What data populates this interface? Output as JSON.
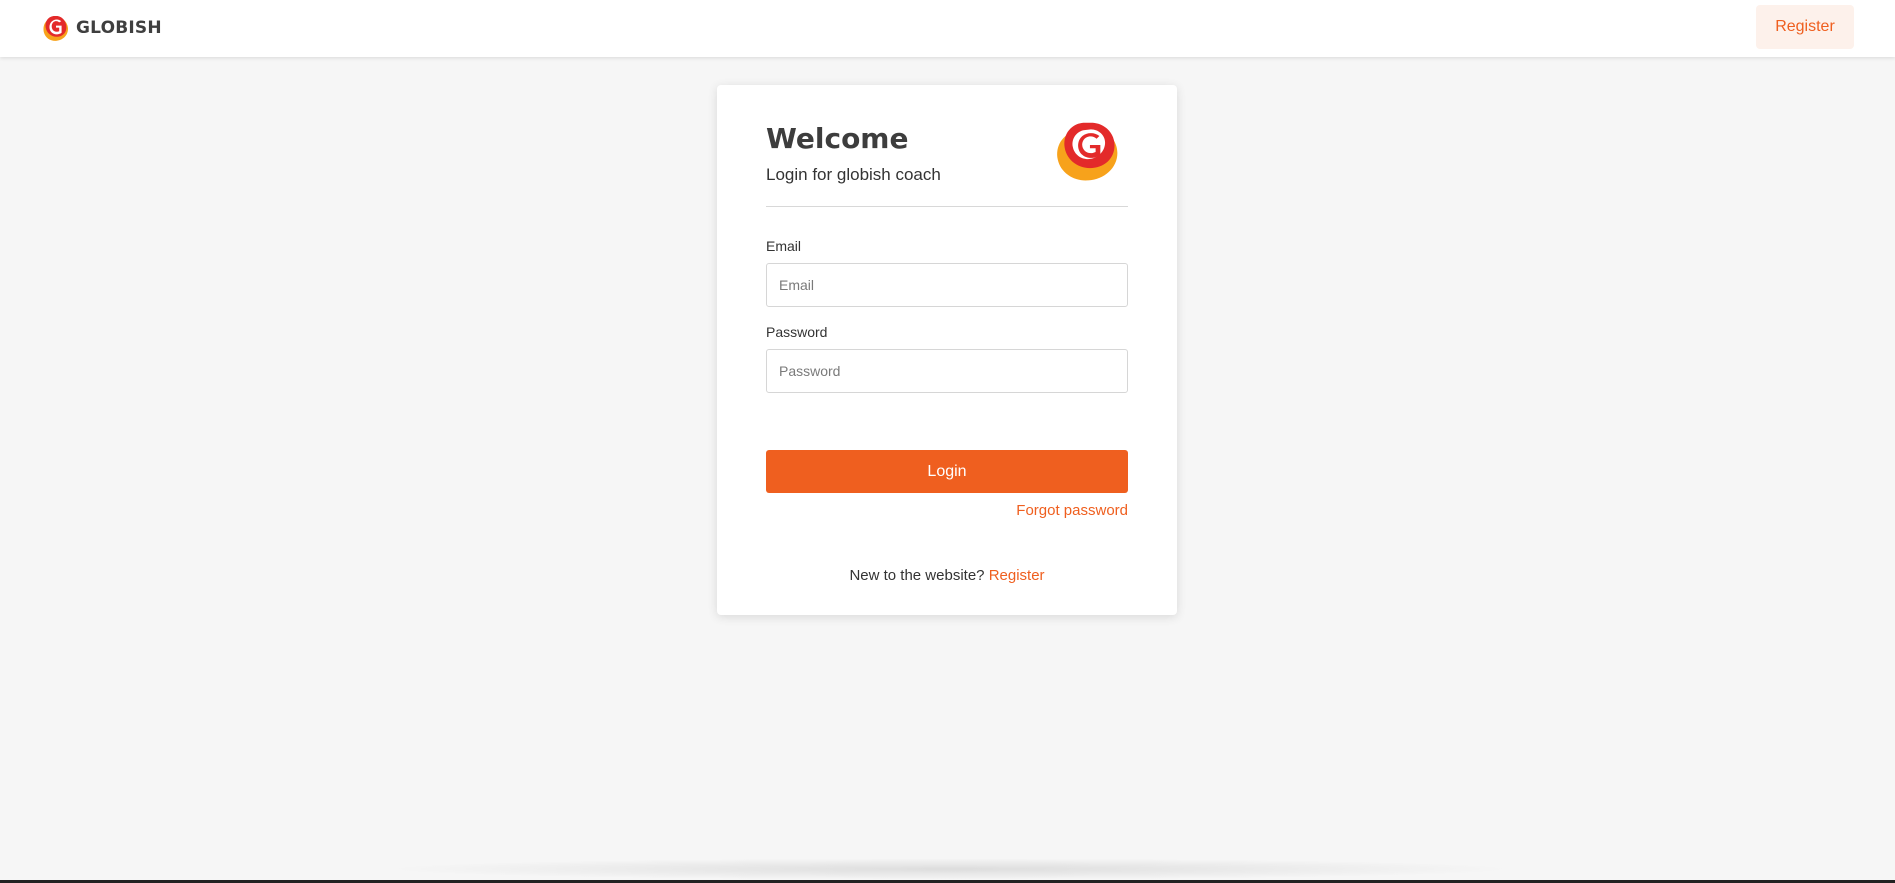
{
  "header": {
    "brand_name": "GLOBISH",
    "register_label": "Register"
  },
  "login_card": {
    "title": "Welcome",
    "subtitle": "Login for globish coach",
    "email": {
      "label": "Email",
      "placeholder": "Email",
      "value": ""
    },
    "password": {
      "label": "Password",
      "placeholder": "Password",
      "value": ""
    },
    "login_label": "Login",
    "forgot_password_label": "Forgot password",
    "register_prompt": "New to the website?",
    "register_link_label": "Register"
  },
  "icons": {
    "brand_logo": "globish-g-logo",
    "card_logo": "globish-g-logo"
  },
  "colors": {
    "accent": "#ef5f1f",
    "accent_soft_bg": "#fdf1eb",
    "page_background": "#f6f6f6",
    "logo_red": "#e32a2a",
    "logo_orange": "#f7a21b"
  }
}
